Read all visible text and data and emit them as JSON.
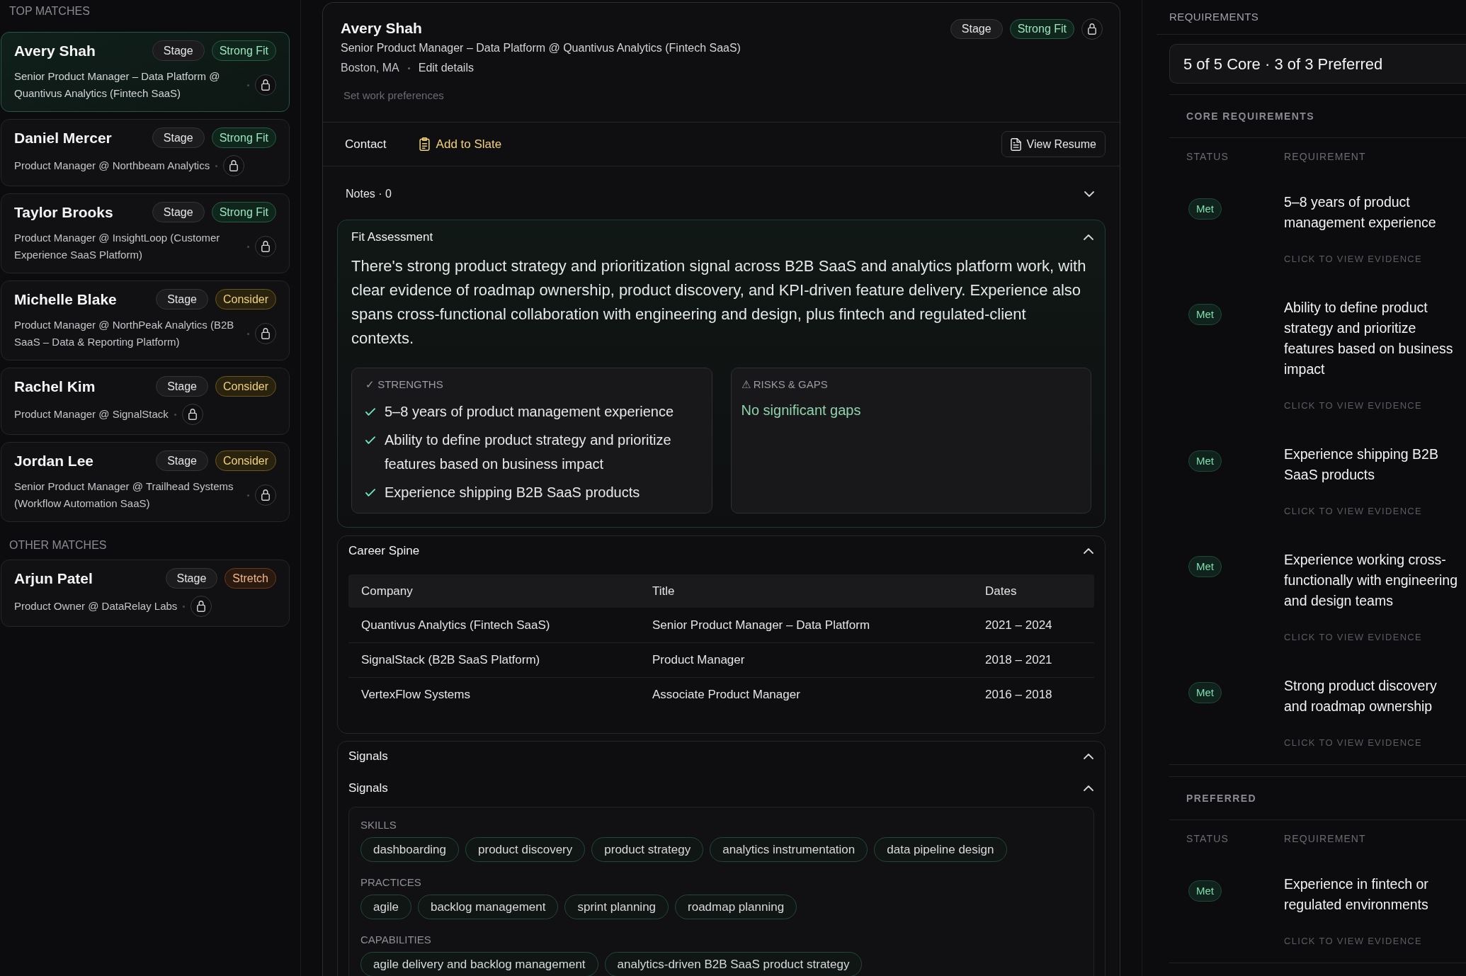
{
  "sidebar": {
    "sections": [
      {
        "title": "TOP MATCHES",
        "candidates": [
          {
            "name": "Avery Shah",
            "stage": "Stage",
            "fit": {
              "label": "Strong Fit",
              "kind": "strong"
            },
            "headline": "Senior Product Manager – Data Platform @ Quantivus Analytics (Fintech SaaS)",
            "selected": true
          },
          {
            "name": "Daniel Mercer",
            "stage": "Stage",
            "fit": {
              "label": "Strong Fit",
              "kind": "strong"
            },
            "headline": "Product Manager @ Northbeam Analytics",
            "selected": false
          },
          {
            "name": "Taylor Brooks",
            "stage": "Stage",
            "fit": {
              "label": "Strong Fit",
              "kind": "strong"
            },
            "headline": "Product Manager @ InsightLoop (Customer Experience SaaS Platform)",
            "selected": false
          },
          {
            "name": "Michelle Blake",
            "stage": "Stage",
            "fit": {
              "label": "Consider",
              "kind": "consider"
            },
            "headline": "Product Manager @ NorthPeak Analytics (B2B SaaS – Data & Reporting Platform)",
            "selected": false
          },
          {
            "name": "Rachel Kim",
            "stage": "Stage",
            "fit": {
              "label": "Consider",
              "kind": "consider"
            },
            "headline": "Product Manager @ SignalStack",
            "selected": false
          },
          {
            "name": "Jordan Lee",
            "stage": "Stage",
            "fit": {
              "label": "Consider",
              "kind": "consider"
            },
            "headline": "Senior Product Manager @ Trailhead Systems (Workflow Automation SaaS)",
            "selected": false
          }
        ]
      },
      {
        "title": "OTHER MATCHES",
        "candidates": [
          {
            "name": "Arjun Patel",
            "stage": "Stage",
            "fit": {
              "label": "Stretch",
              "kind": "stretch"
            },
            "headline": "Product Owner @ DataRelay Labs",
            "selected": false
          }
        ]
      }
    ]
  },
  "profile": {
    "name": "Avery Shah",
    "headline": "Senior Product Manager – Data Platform @ Quantivus Analytics (Fintech SaaS)",
    "location": "Boston, MA",
    "edit_link": "Edit details",
    "preferences_link": "Set work preferences",
    "stage": "Stage",
    "fit": {
      "label": "Strong Fit",
      "kind": "strong"
    }
  },
  "actions": {
    "contact": "Contact",
    "add_to_slate": "Add to Slate",
    "view_resume": "View Resume"
  },
  "notes": {
    "label": "Notes · 0",
    "expanded": false
  },
  "fit_assessment": {
    "title": "Fit Assessment",
    "expanded": true,
    "summary": "There's strong product strategy and prioritization signal across B2B SaaS and analytics platform work, with clear evidence of roadmap ownership, product discovery, and KPI-driven feature delivery. Experience also spans cross-functional collaboration with engineering and design, plus fintech and regulated-client contexts.",
    "strengths": {
      "title": "✓ STRENGTHS",
      "items": [
        "5–8 years of product management experience",
        "Ability to define product strategy and prioritize features based on business impact",
        "Experience shipping B2B SaaS products"
      ]
    },
    "risks": {
      "title": "⚠ RISKS & GAPS",
      "items": [
        "No significant gaps"
      ]
    }
  },
  "career_spine": {
    "title": "Career Spine",
    "expanded": true,
    "columns": [
      "Company",
      "Title",
      "Dates"
    ],
    "rows": [
      [
        "Quantivus Analytics (Fintech SaaS)",
        "Senior Product Manager – Data Platform",
        "2021 – 2024"
      ],
      [
        "SignalStack (B2B SaaS Platform)",
        "Product Manager",
        "2018 – 2021"
      ],
      [
        "VertexFlow Systems",
        "Associate Product Manager",
        "2016 – 2018"
      ]
    ]
  },
  "signals": {
    "title": "Signals",
    "expanded": true,
    "panel": {
      "title": "Signals",
      "expanded": true,
      "groups": [
        {
          "title": "SKILLS",
          "tags": [
            "dashboarding",
            "product discovery",
            "product strategy",
            "analytics instrumentation",
            "data pipeline design"
          ]
        },
        {
          "title": "PRACTICES",
          "tags": [
            "agile",
            "backlog management",
            "sprint planning",
            "roadmap planning"
          ]
        },
        {
          "title": "CAPABILITIES",
          "tags": [
            "agile delivery and backlog management",
            "analytics-driven B2B SaaS product strategy"
          ]
        }
      ]
    }
  },
  "requirements": {
    "title": "REQUIREMENTS",
    "summary": "5 of 5 Core · 3 of 3 Preferred",
    "sections": [
      {
        "title": "CORE REQUIREMENTS",
        "columns": [
          "STATUS",
          "REQUIREMENT"
        ],
        "items": [
          {
            "status": "Met",
            "text": "5–8 years of product management experience",
            "link": "CLICK TO VIEW EVIDENCE"
          },
          {
            "status": "Met",
            "text": "Ability to define product strategy and prioritize features based on business impact",
            "link": "CLICK TO VIEW EVIDENCE"
          },
          {
            "status": "Met",
            "text": "Experience shipping B2B SaaS products",
            "link": "CLICK TO VIEW EVIDENCE"
          },
          {
            "status": "Met",
            "text": "Experience working cross-functionally with engineering and design teams",
            "link": "CLICK TO VIEW EVIDENCE"
          },
          {
            "status": "Met",
            "text": "Strong product discovery and roadmap ownership",
            "link": "CLICK TO VIEW EVIDENCE"
          }
        ]
      },
      {
        "title": "PREFERRED",
        "columns": [
          "STATUS",
          "REQUIREMENT"
        ],
        "items": [
          {
            "status": "Met",
            "text": "Experience in fintech or regulated environments",
            "link": "CLICK TO VIEW EVIDENCE"
          }
        ]
      }
    ]
  }
}
